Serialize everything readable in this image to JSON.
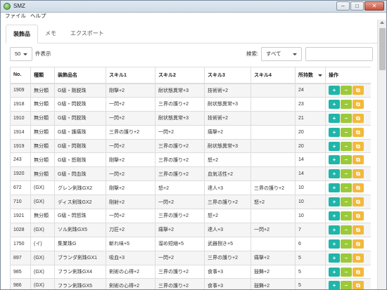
{
  "window": {
    "title": "SMZ",
    "controls": [
      "–",
      "□",
      "✕"
    ]
  },
  "menubar": {
    "items": [
      "ファイル",
      "ヘルプ"
    ]
  },
  "tabs": [
    {
      "label": "装飾品",
      "active": true
    },
    {
      "label": "メモ",
      "active": false
    },
    {
      "label": "エクスポート",
      "active": false
    }
  ],
  "controls": {
    "page_size": "50",
    "page_size_suffix": "件表示",
    "search_label": "検索:",
    "filter_value": "すべて",
    "search_value": ""
  },
  "table": {
    "columns": [
      "No.",
      "種類",
      "装飾品名",
      "スキル1",
      "スキル2",
      "スキル3",
      "スキル4",
      "所持数",
      "操作"
    ],
    "sorted_column": "所持数",
    "actions": {
      "add": "+",
      "minus": "−",
      "copy": "⧉"
    },
    "rows": [
      [
        "1909",
        "無分類",
        "G級・剛脱珠",
        "剛撃+2",
        "耐状態異常+3",
        "技術術+2",
        "",
        "24"
      ],
      [
        "1918",
        "無分類",
        "G級・閃脱珠",
        "一閃+2",
        "三界の護り+2",
        "耐状態異常+3",
        "",
        "23"
      ],
      [
        "1910",
        "無分類",
        "G級・閃脱珠",
        "一閃+2",
        "耐状態異常+3",
        "技術術+2",
        "",
        "21"
      ],
      [
        "1914",
        "無分類",
        "G級・護痛珠",
        "三界の護り+2",
        "一閃+2",
        "痛撃+2",
        "",
        "20"
      ],
      [
        "1919",
        "無分類",
        "G級・閃剛珠",
        "一閃+2",
        "三界の護り+2",
        "耐状態異常+3",
        "",
        "20"
      ],
      [
        "243",
        "無分類",
        "G級・怒剛珠",
        "剛撃+2",
        "三界の護り+2",
        "怒+2",
        "",
        "14"
      ],
      [
        "1920",
        "無分類",
        "G級・閃血珠",
        "一閃+2",
        "三界の護り+2",
        "血気活性+2",
        "",
        "14"
      ],
      [
        "672",
        "(GX)",
        "グレン剣珠GX2",
        "剛撃+2",
        "怒+2",
        "達人+3",
        "三界の護り+2",
        "10"
      ],
      [
        "710",
        "(GX)",
        "ディス剣珠GX2",
        "剛射+2",
        "一閃+2",
        "三界の護り+2",
        "怒+2",
        "10"
      ],
      [
        "1921",
        "無分類",
        "G級・閃怒珠",
        "一閃+2",
        "三界の護り+2",
        "怒+2",
        "",
        "10"
      ],
      [
        "1028",
        "(GX)",
        "ソル剣珠GX5",
        "刀匠+2",
        "痛撃+2",
        "達人+3",
        "一閃+2",
        "7"
      ],
      [
        "1750",
        "(イ)",
        "集業珠G",
        "斬れ味+5",
        "溜め短縮+5",
        "武器捌き+5",
        "",
        "6"
      ],
      [
        "897",
        "(GX)",
        "ブランダ剣珠GX1",
        "吸血+3",
        "一閃+2",
        "三界の護り+2",
        "痛撃+2",
        "5"
      ],
      [
        "985",
        "(GX)",
        "フラン剣珠GX4",
        "剣術の心得+2",
        "三界の護り+2",
        "食事+3",
        "鼓舞+2",
        "5"
      ],
      [
        "986",
        "(GX)",
        "フラン剣珠GX5",
        "剣術の心得+2",
        "三界の護り+2",
        "食事+3",
        "鼓舞+2",
        "5"
      ]
    ]
  }
}
